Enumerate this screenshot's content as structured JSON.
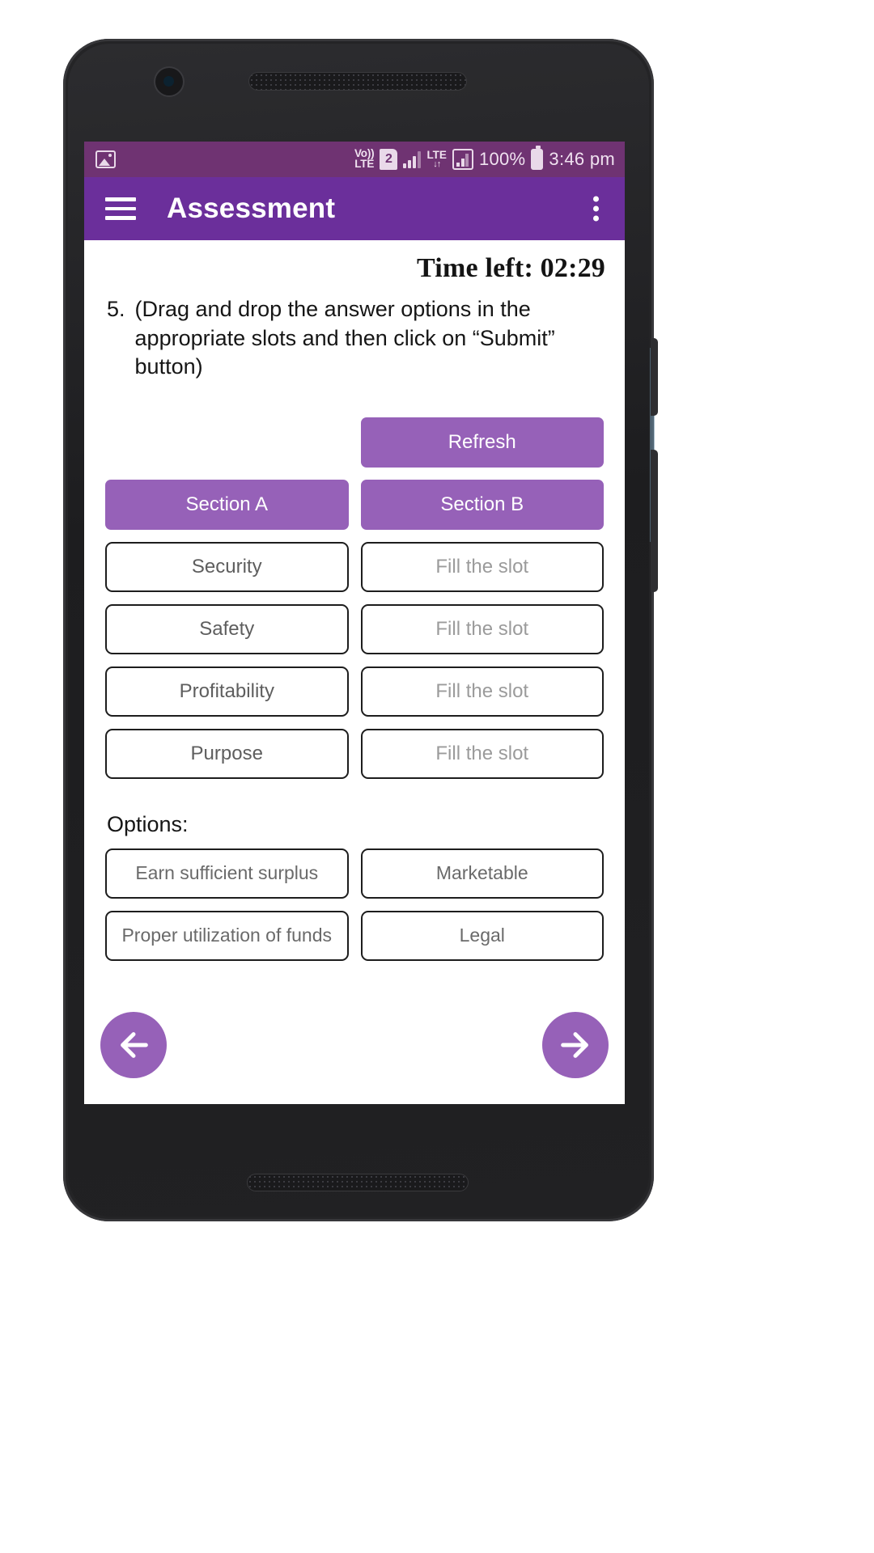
{
  "device": {
    "chassis_color": "#242426",
    "accent_button_color": "#6b8fa8"
  },
  "statusbar": {
    "background": "#6f3372",
    "photo_icon": "image-icon",
    "volte_line1": "Vo))",
    "volte_line2": "LTE",
    "sim_badge": "2",
    "network_label": "LTE",
    "data_arrows": "↓↑",
    "battery_percent": "100%",
    "time": "3:46 pm"
  },
  "appbar": {
    "background": "#6b2f9b",
    "menu_icon": "hamburger-menu-icon",
    "title": "Assessment",
    "overflow_icon": "more-vertical-icon"
  },
  "main": {
    "timer_label": "Time left: 02:29",
    "question_number": "5.",
    "question_text": "(Drag and drop the answer options in the appropriate slots and then click on “Submit” button)",
    "refresh_label": "Refresh",
    "section_a_label": "Section A",
    "section_b_label": "Section B",
    "accent_button_color": "#9661b8",
    "pairs": [
      {
        "left": "Security",
        "right": "Fill the slot"
      },
      {
        "left": "Safety",
        "right": "Fill the slot"
      },
      {
        "left": "Profitability",
        "right": "Fill the slot"
      },
      {
        "left": "Purpose",
        "right": "Fill the slot"
      }
    ],
    "options_label": "Options:",
    "options": [
      {
        "left": "Earn sufficient surplus",
        "right": "Marketable"
      },
      {
        "left": "Proper utilization of funds",
        "right": "Legal"
      }
    ]
  },
  "nav": {
    "prev_icon": "arrow-left-icon",
    "next_icon": "arrow-right-icon"
  }
}
